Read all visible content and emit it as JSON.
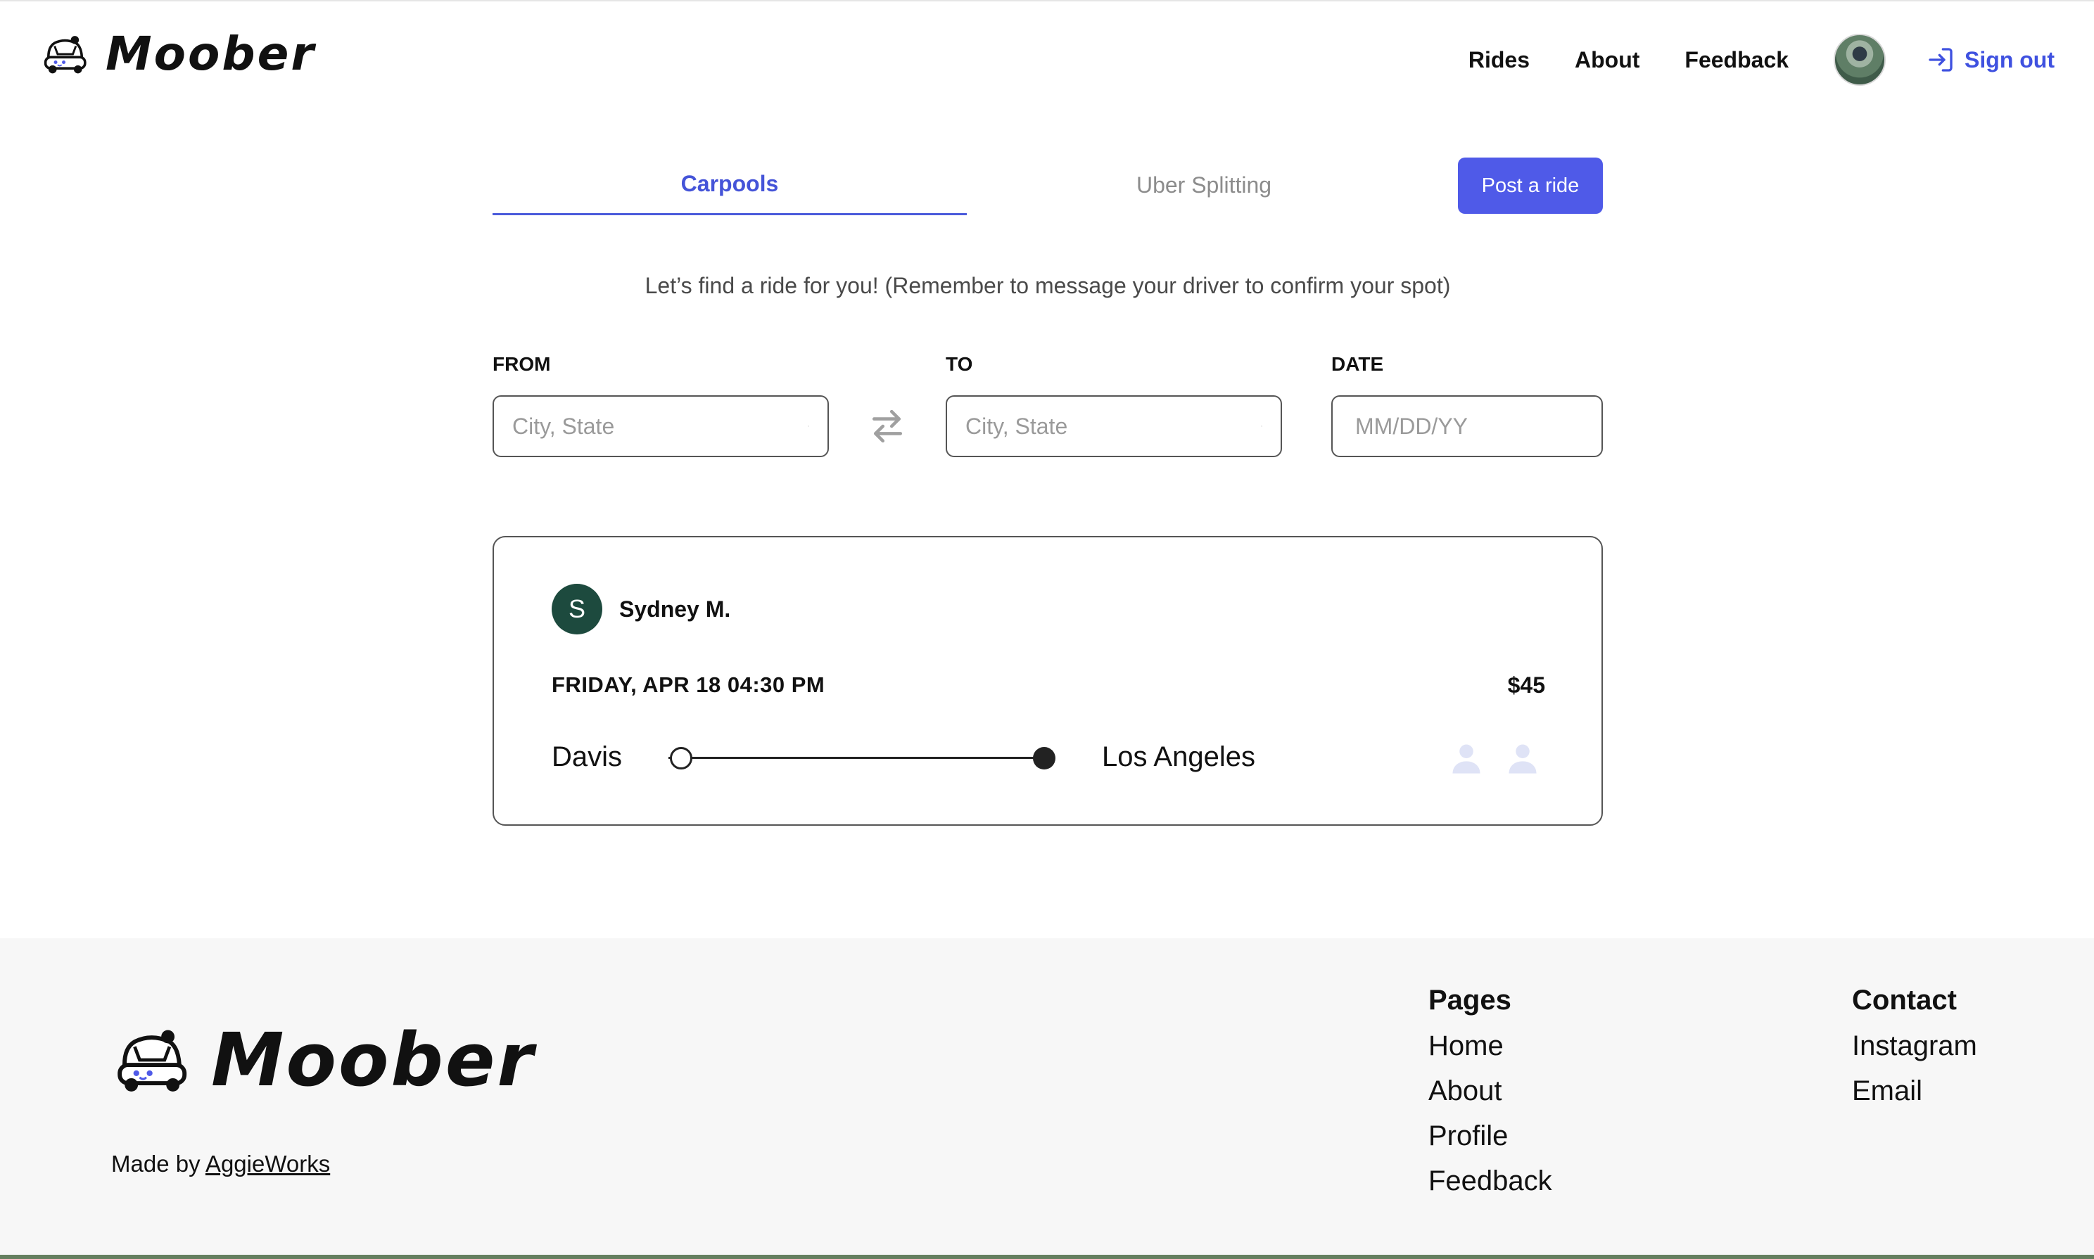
{
  "app": {
    "brand_name": "Moober"
  },
  "header": {
    "nav": [
      "Rides",
      "About",
      "Feedback"
    ],
    "sign_out": "Sign out"
  },
  "tabs": {
    "carpools": "Carpools",
    "uber_splitting": "Uber Splitting",
    "post_ride": "Post a ride"
  },
  "subtitle": "Let’s find a ride for you! (Remember to message your driver to confirm your spot)",
  "search": {
    "from_label": "FROM",
    "from_placeholder": "City, State",
    "to_label": "TO",
    "to_placeholder": "City, State",
    "date_label": "DATE",
    "date_placeholder": "MM/DD/YY"
  },
  "ride": {
    "driver_initial": "S",
    "driver_name": "Sydney M.",
    "datetime": "FRIDAY, APR 18 04:30 PM",
    "price": "$45",
    "origin": "Davis",
    "destination": "Los Angeles",
    "seats_available": 2
  },
  "colors": {
    "accent": "#4f5ae8",
    "driver_avatar": "#1d4a3e",
    "seat_icon": "#dfe3f6",
    "footer_bg": "#f7f7f7"
  },
  "footer": {
    "brand_name": "Moober",
    "made_by_prefix": "Made by",
    "made_by_link": "AggieWorks",
    "pages_heading": "Pages",
    "pages": [
      "Home",
      "About",
      "Profile",
      "Feedback"
    ],
    "contact_heading": "Contact",
    "contact": [
      "Instagram",
      "Email"
    ]
  }
}
